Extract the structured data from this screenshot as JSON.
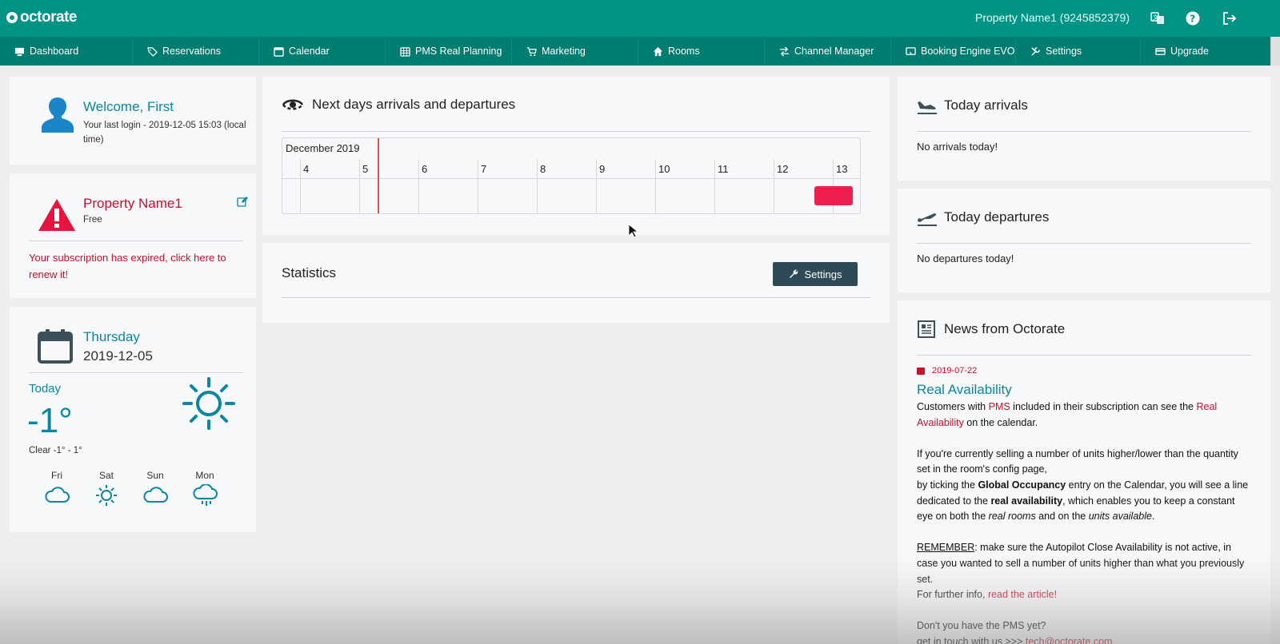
{
  "app": {
    "logo_text": "octorate",
    "property_label": "Property Name1 (9245852379)",
    "icons": [
      "language-icon",
      "help-icon",
      "logout-icon"
    ]
  },
  "nav": {
    "items": [
      {
        "label": "Dashboard",
        "icon": "dashboard-icon"
      },
      {
        "label": "Reservations",
        "icon": "tag-icon"
      },
      {
        "label": "Calendar",
        "icon": "calendar-icon"
      },
      {
        "label": "PMS Real Planning",
        "icon": "grid-calendar-icon"
      },
      {
        "label": "Marketing",
        "icon": "cart-icon"
      },
      {
        "label": "Rooms",
        "icon": "home-icon"
      },
      {
        "label": "Channel Manager",
        "icon": "exchange-icon"
      },
      {
        "label": "Booking Engine EVO",
        "icon": "booking-engine-icon"
      },
      {
        "label": "Settings",
        "icon": "tools-icon"
      },
      {
        "label": "Upgrade",
        "icon": "credit-card-icon"
      }
    ]
  },
  "welcome": {
    "title": "Welcome, First",
    "last_login": "Your last login - 2019-12-05 15:03 (local time)"
  },
  "property": {
    "name": "Property Name1",
    "plan": "Free",
    "expired_msg": "Your subscription has expired, click here to renew it!"
  },
  "weather": {
    "day_name": "Thursday",
    "date": "2019-12-05",
    "today_label": "Today",
    "temperature": "-1°",
    "condition": "Clear -1° - 1°",
    "forecast": [
      {
        "day": "Fri",
        "icon": "cloud-icon"
      },
      {
        "day": "Sat",
        "icon": "sun-icon"
      },
      {
        "day": "Sun",
        "icon": "cloud-icon"
      },
      {
        "day": "Mon",
        "icon": "rain-cloud-icon"
      }
    ]
  },
  "arrivals_departures": {
    "title": "Next days arrivals and departures",
    "month": "December 2019",
    "days": [
      "4",
      "5",
      "6",
      "7",
      "8",
      "9",
      "10",
      "11",
      "12",
      "13"
    ]
  },
  "statistics": {
    "title": "Statistics",
    "settings_label": "Settings"
  },
  "today_arrivals": {
    "title": "Today arrivals",
    "empty": "No arrivals today!"
  },
  "today_departures": {
    "title": "Today departures",
    "empty": "No departures today!"
  },
  "news": {
    "title": "News from Octorate",
    "date": "2019-07-22",
    "article_title": "Real Availability",
    "p1_a": "Customers with ",
    "p1_pms": "PMS",
    "p1_b": " included in their subscription can see the ",
    "p1_real": "Real Availability",
    "p1_c": " on the calendar.",
    "p2_line1": "If you're currently selling a number of units higher/lower than the quantity set in the room's config page,",
    "p2_a": "by ticking the ",
    "p2_global": "Global Occupancy",
    "p2_b": " entry on the Calendar, you will see a line dedicated to the ",
    "p2_real": "real availability",
    "p2_c": ", which enables you to keep a constant eye on both the ",
    "p2_rooms": "real rooms",
    "p2_d": " and on the ",
    "p2_units": "units available",
    "p2_e": ".",
    "p3_remember": "REMEMBER",
    "p3_a": ": make sure the Autopilot Close Availability is not active, in case you wanted to sell a number of units higher than what you previously set.",
    "p3_b": "For further info, ",
    "p3_link": "read the article!",
    "p4_a": "Don't you have the PMS yet?",
    "p4_b": "get in touch with us >>> ",
    "p4_email": "tech@octorate.com"
  }
}
